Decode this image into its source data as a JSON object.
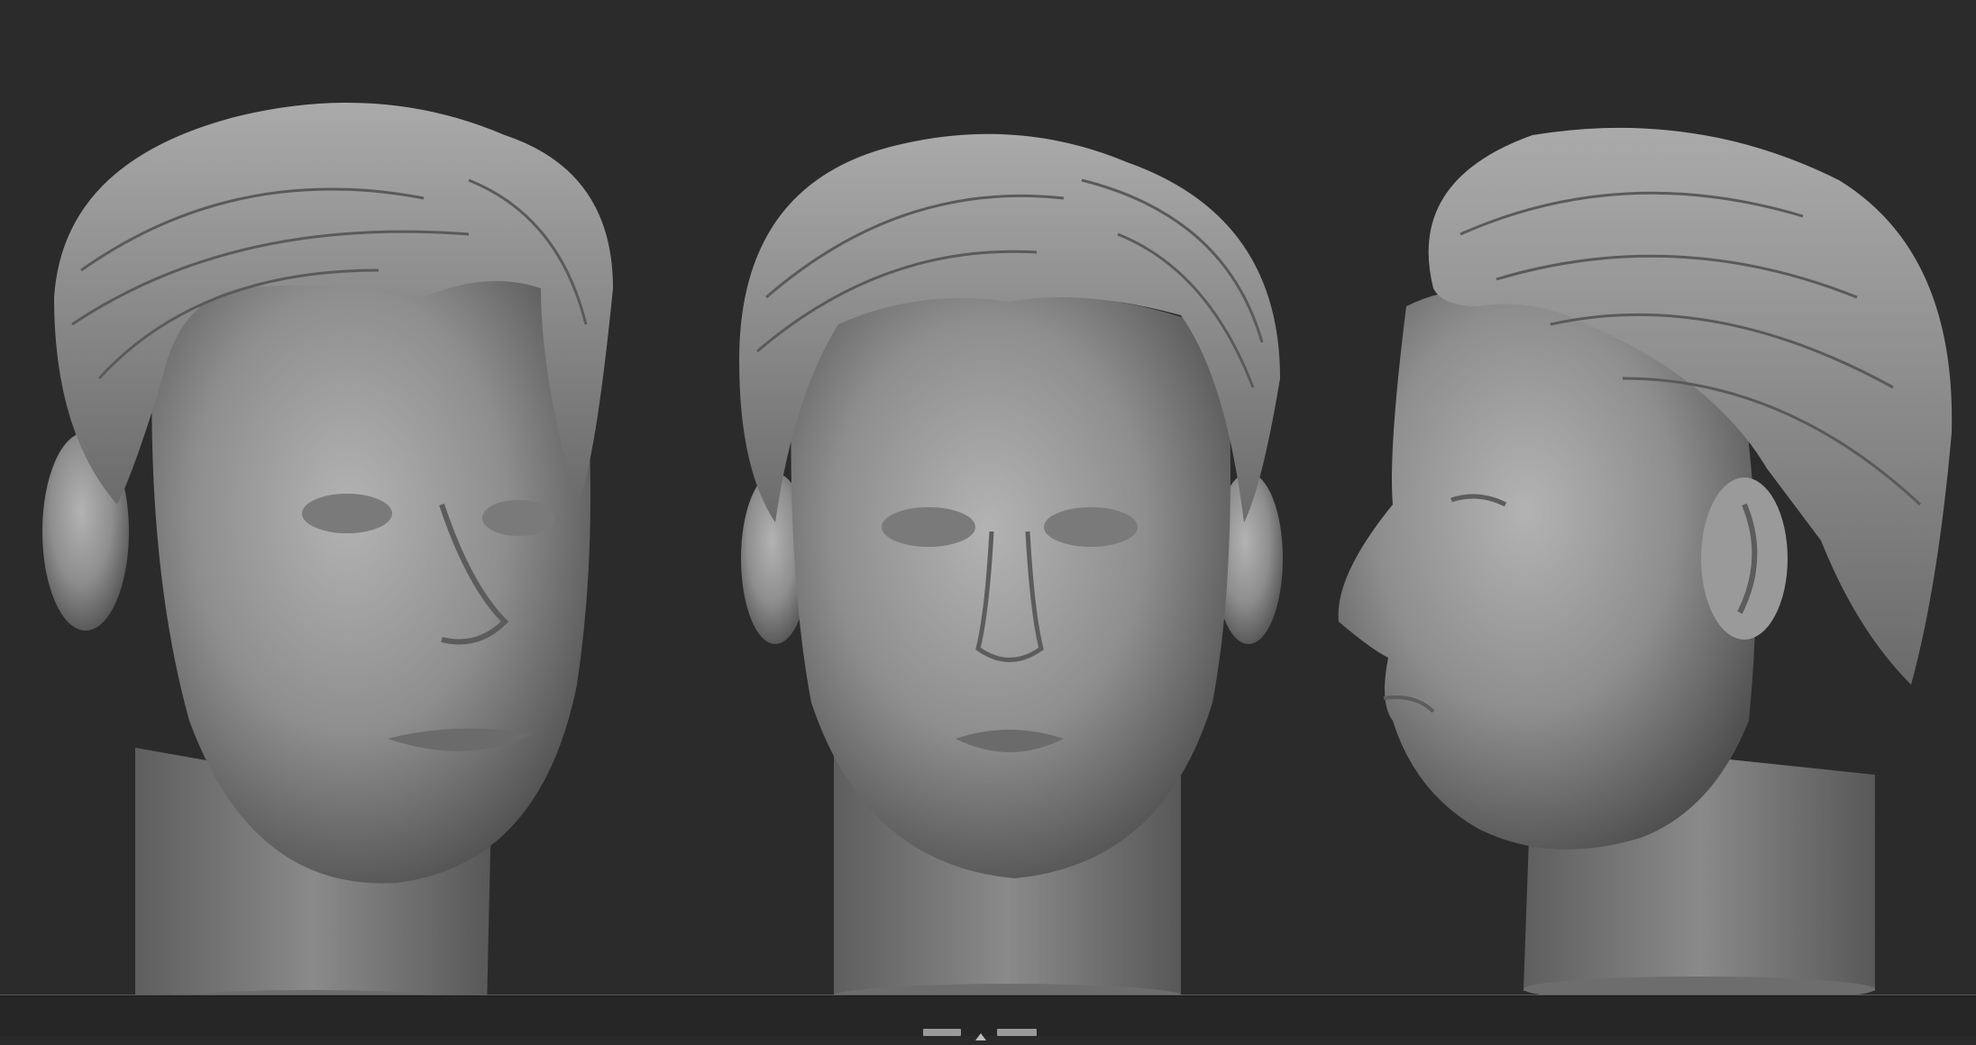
{
  "app": {
    "background": "#2b2b2b"
  },
  "viewport": {
    "subjects": [
      {
        "view": "three-quarter-left",
        "icon": "sculpt-head"
      },
      {
        "view": "front",
        "icon": "sculpt-head"
      },
      {
        "view": "profile-right",
        "icon": "sculpt-head"
      }
    ],
    "material_color": "#8c8c8c"
  },
  "bottom_bar": {
    "handles": [
      "left-handle",
      "center-marker",
      "right-handle"
    ]
  }
}
